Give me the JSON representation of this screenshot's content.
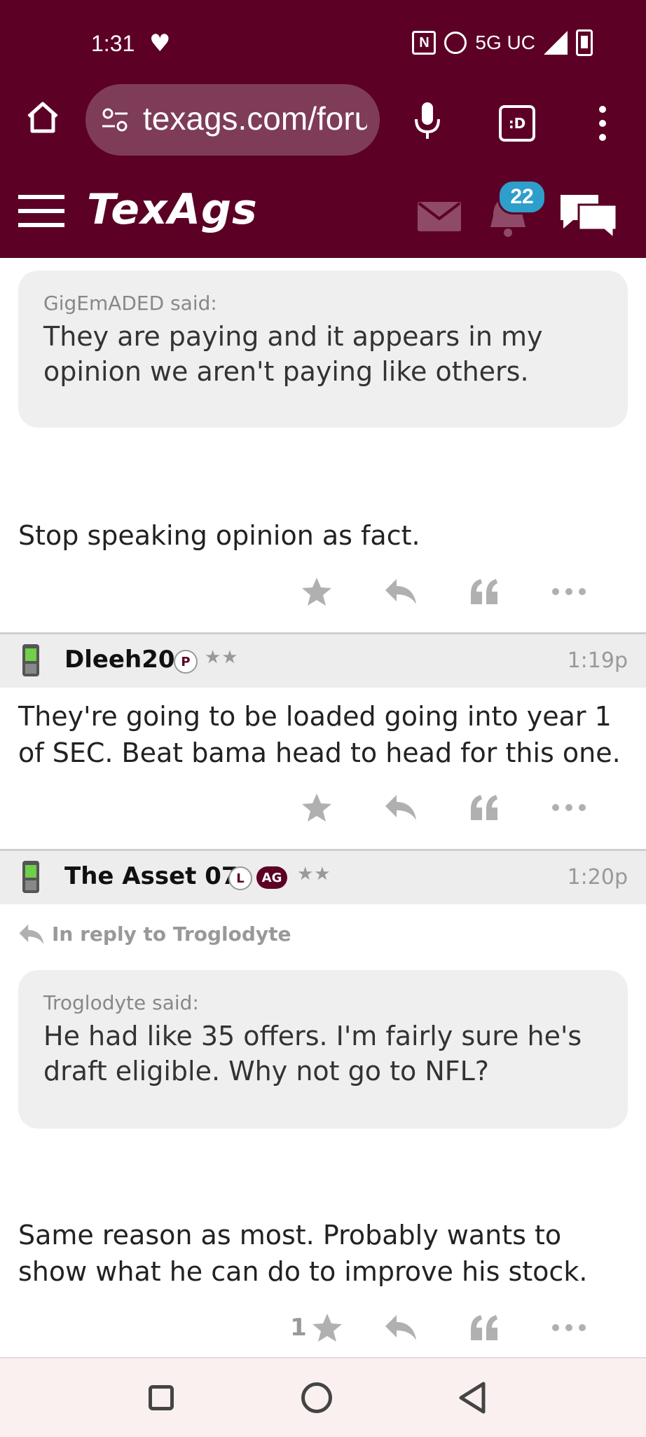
{
  "status_bar": {
    "time": "1:31",
    "network": "5G UC"
  },
  "browser": {
    "url": "texags.com/forums",
    "tabs_label": ":D"
  },
  "site": {
    "logo": "TexAgs",
    "notification_count": "22",
    "colors": {
      "brand": "#5c0025",
      "badge": "#2e9ecb"
    }
  },
  "posts": [
    {
      "quote_author": "GigEmADED said:",
      "quote_text": "They are paying and it appears in my opinion we aren't paying like others.",
      "body": "Stop speaking opinion as fact."
    },
    {
      "username": "Dleeh20",
      "tag": "P",
      "stars": "★★",
      "time": "1:19p",
      "body": "They're going to be loaded going into year 1 of SEC. Beat bama head to head for this one."
    },
    {
      "username": "The Asset 07",
      "tag": "L",
      "tag2": "AG",
      "stars": "★★",
      "time": "1:20p",
      "reply_to": "In reply to Troglodyte",
      "quote_author": "Troglodyte said:",
      "quote_text": "He had like 35 offers. I'm fairly sure he's draft eligible. Why not go to NFL?",
      "body": "Same reason as most. Probably wants to show what he can do to improve his stock.",
      "star_count": "1"
    }
  ]
}
